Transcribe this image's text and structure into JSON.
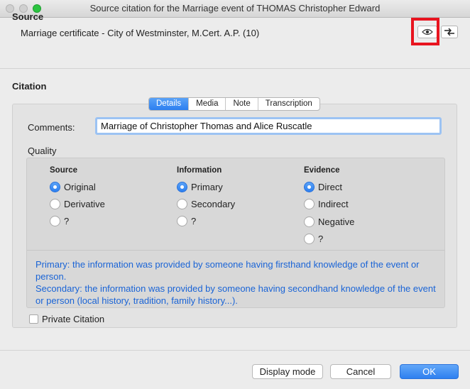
{
  "window": {
    "title": "Source citation for the Marriage event of THOMAS Christopher Edward"
  },
  "source": {
    "heading": "Source",
    "text": "Marriage certificate - City of Westminster, M.Cert. A.P. (10)"
  },
  "citation": {
    "heading": "Citation",
    "tabs": [
      {
        "label": "Details",
        "active": true
      },
      {
        "label": "Media",
        "active": false
      },
      {
        "label": "Note",
        "active": false
      },
      {
        "label": "Transcription",
        "active": false
      }
    ],
    "comments_label": "Comments:",
    "comments_value": "Marriage of Christopher Thomas and Alice Ruscatle",
    "quality_label": "Quality",
    "columns": [
      {
        "heading": "Source",
        "options": [
          "Original",
          "Derivative",
          "?"
        ],
        "selected": "Original"
      },
      {
        "heading": "Information",
        "options": [
          "Primary",
          "Secondary",
          "?"
        ],
        "selected": "Primary"
      },
      {
        "heading": "Evidence",
        "options": [
          "Direct",
          "Indirect",
          "Negative",
          "?"
        ],
        "selected": "Direct"
      }
    ],
    "help_primary": "Primary: the information was provided by someone having firsthand knowledge of the event or person.",
    "help_secondary": "Secondary: the information was provided by someone having secondhand knowledge of the event or person (local history, tradition, family history...).",
    "private_label": "Private Citation",
    "private_checked": false
  },
  "buttons": {
    "display_mode": "Display mode",
    "cancel": "Cancel",
    "ok": "OK"
  },
  "icons": {
    "view": "eye-icon",
    "swap": "swap-arrows-icon"
  },
  "colors": {
    "accent": "#2c7ff0",
    "highlight": "#e8141f",
    "help_text": "#1a64d6"
  }
}
